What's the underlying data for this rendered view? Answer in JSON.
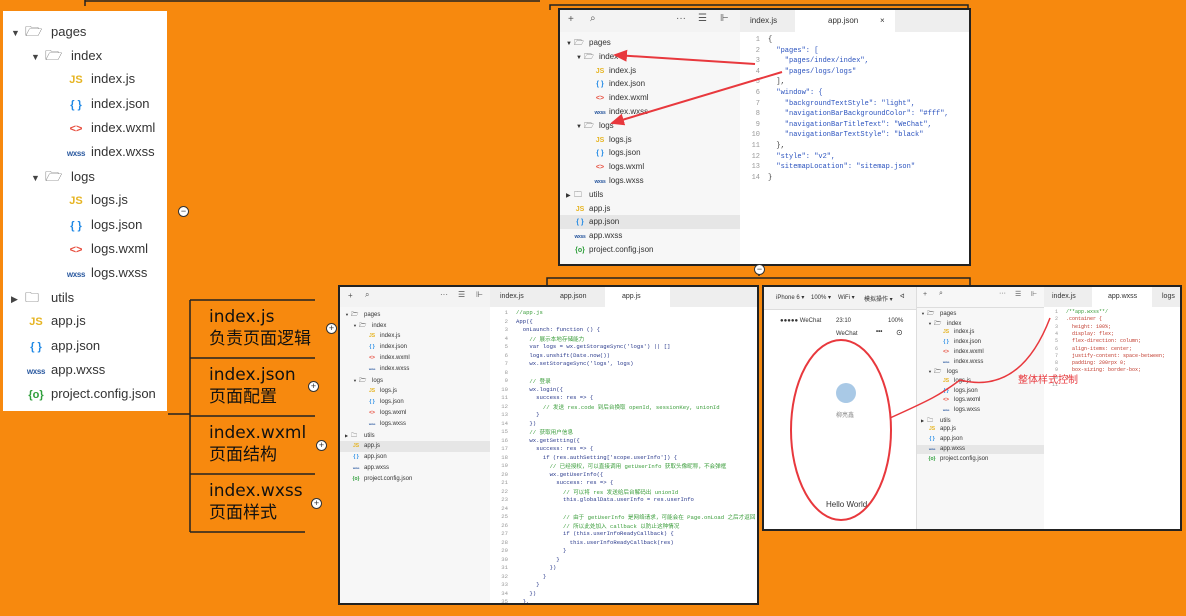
{
  "left_tree": {
    "items": [
      {
        "arrow": "▼",
        "icon": "folder-open",
        "label": "pages"
      },
      {
        "arrow": "▼",
        "icon": "folder-open",
        "label": "index"
      },
      {
        "icon": "JS",
        "label": "index.js"
      },
      {
        "icon": "{ }",
        "label": "index.json"
      },
      {
        "icon": "<>",
        "label": "index.wxml"
      },
      {
        "icon": "wxss",
        "label": "index.wxss"
      },
      {
        "arrow": "▼",
        "icon": "folder-open",
        "label": "logs"
      },
      {
        "icon": "JS",
        "label": "logs.js"
      },
      {
        "icon": "{ }",
        "label": "logs.json"
      },
      {
        "icon": "<>",
        "label": "logs.wxml"
      },
      {
        "icon": "wxss",
        "label": "logs.wxss"
      },
      {
        "arrow": "▶",
        "icon": "folder",
        "label": "utils"
      },
      {
        "icon": "JS",
        "label": "app.js"
      },
      {
        "icon": "{ }",
        "label": "app.json"
      },
      {
        "icon": "wxss",
        "label": "app.wxss"
      },
      {
        "icon": "{o}",
        "label": "project.config.json"
      }
    ]
  },
  "branches": [
    {
      "name": "index.js",
      "desc": "负责页面逻辑"
    },
    {
      "name": "index.json",
      "desc": "页面配置"
    },
    {
      "name": "index.wxml",
      "desc": "页面结构"
    },
    {
      "name": "index.wxss",
      "desc": "页面样式"
    }
  ],
  "ide_top": {
    "tabs": [
      "index.js",
      "app.json"
    ],
    "tree": [
      "pages",
      "index",
      "index.js",
      "index.json",
      "index.wxml",
      "index.wxss",
      "logs",
      "logs.js",
      "logs.json",
      "logs.wxml",
      "logs.wxss",
      "utils",
      "app.js",
      "app.json",
      "app.wxss",
      "project.config.json"
    ],
    "code": [
      "{",
      "  \"pages\": [",
      "    \"pages/index/index\",",
      "    \"pages/logs/logs\"",
      "  ],",
      "  \"window\": {",
      "    \"backgroundTextStyle\": \"light\",",
      "    \"navigationBarBackgroundColor\": \"#fff\",",
      "    \"navigationBarTitleText\": \"WeChat\",",
      "    \"navigationBarTextStyle\": \"black\"",
      "  },",
      "  \"style\": \"v2\",",
      "  \"sitemapLocation\": \"sitemap.json\"",
      "}"
    ]
  },
  "ide_bottom_left": {
    "tabs": [
      "index.js",
      "app.json",
      "app.js"
    ],
    "tree": [
      "pages",
      "index",
      "index.js",
      "index.json",
      "index.wxml",
      "index.wxss",
      "logs",
      "logs.js",
      "logs.json",
      "logs.wxml",
      "logs.wxss",
      "utils",
      "app.js",
      "app.json",
      "app.wxss",
      "project.config.json"
    ],
    "code": [
      "//app.js",
      "App({",
      "  onLaunch: function () {",
      "    // 展示本地存储能力",
      "    var logs = wx.getStorageSync('logs') || []",
      "    logs.unshift(Date.now())",
      "    wx.setStorageSync('logs', logs)",
      "",
      "    // 登录",
      "    wx.login({",
      "      success: res => {",
      "        // 发送 res.code 到后台换取 openId, sessionKey, unionId",
      "      }",
      "    })",
      "    // 获取用户信息",
      "    wx.getSetting({",
      "      success: res => {",
      "        if (res.authSetting['scope.userInfo']) {",
      "          // 已经授权，可以直接调用 getUserInfo 获取头像昵称，不会弹框",
      "          wx.getUserInfo({",
      "            success: res => {",
      "              // 可以将 res 发送给后台解码出 unionId",
      "              this.globalData.userInfo = res.userInfo",
      "",
      "              // 由于 getUserInfo 是网络请求，可能会在 Page.onLoad 之后才返回",
      "              // 所以此处加入 callback 以防止这种情况",
      "              if (this.userInfoReadyCallback) {",
      "                this.userInfoReadyCallback(res)",
      "              }",
      "            }",
      "          })",
      "        }",
      "      }",
      "    })",
      "  },"
    ]
  },
  "ide_bottom_right": {
    "toolbar": [
      "iPhone 6 ▾",
      "100% ▾",
      "WiFi ▾",
      "模拟操作 ▾"
    ],
    "tabs": [
      "index.js",
      "app.wxss",
      "logs"
    ],
    "phone": {
      "carrier": "●●●●● WeChat",
      "time": "23:10",
      "battery": "100%",
      "title": "WeChat",
      "nickname": "柳亮鑫",
      "hello": "Hello World"
    },
    "tree": [
      "pages",
      "index",
      "index.js",
      "index.json",
      "index.wxml",
      "index.wxss",
      "logs",
      "logs.js",
      "logs.json",
      "logs.wxml",
      "logs.wxss",
      "utils",
      "app.js",
      "app.json",
      "app.wxss",
      "project.config.json"
    ],
    "code": [
      "/**app.wxss**/",
      ".container {",
      "  height: 100%;",
      "  display: flex;",
      "  flex-direction: column;",
      "  align-items: center;",
      "  justify-content: space-between;",
      "  padding: 200rpx 0;",
      "  box-sizing: border-box;",
      "}",
      ""
    ],
    "annotation": "整体样式控制"
  },
  "colors": {
    "background": "#f7890e",
    "arrow": "#e8383d",
    "selected": "#e6e6e6"
  }
}
